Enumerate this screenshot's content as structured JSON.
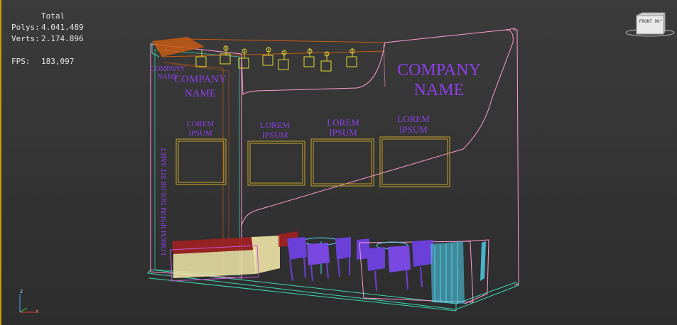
{
  "stats": {
    "header": "Total",
    "polys_label": "Polys:",
    "polys_value": "4.041.489",
    "verts_label": "Verts:",
    "verts_value": "2.174.896",
    "fps_label": "FPS:",
    "fps_value": "183,097"
  },
  "viewcube": {
    "label": "FRONT 90°"
  },
  "axis": {
    "z": "z",
    "x": "x"
  },
  "booth": {
    "company_big": [
      "COMPANY",
      "NAME"
    ],
    "company_left": [
      "COMPANY",
      "NAME"
    ],
    "company_small": [
      "COMPANY",
      "NAME"
    ],
    "panels": [
      {
        "line1": "LOREM",
        "line2": "IPSUM"
      },
      {
        "line1": "LOREM",
        "line2": "IPSUM"
      },
      {
        "line1": "LOREM",
        "line2": "IPSUM"
      },
      {
        "line1": "LOREM",
        "line2": "IPSUM"
      }
    ],
    "vertical_text": "LOREM IPSUM DOLOR SIT AMET"
  },
  "colors": {
    "text_purple": "#8c40e8",
    "wall_pink": "#ff9ad2",
    "frame_yellow": "#c8a52a",
    "floor_green": "#3dd6b0",
    "sofa_red": "#a82020",
    "sofa_cream": "#f0e6a8",
    "chair_purple": "#6a40d8",
    "counter_cyan": "#4fd4f0",
    "wood_orange": "#c85a14"
  }
}
